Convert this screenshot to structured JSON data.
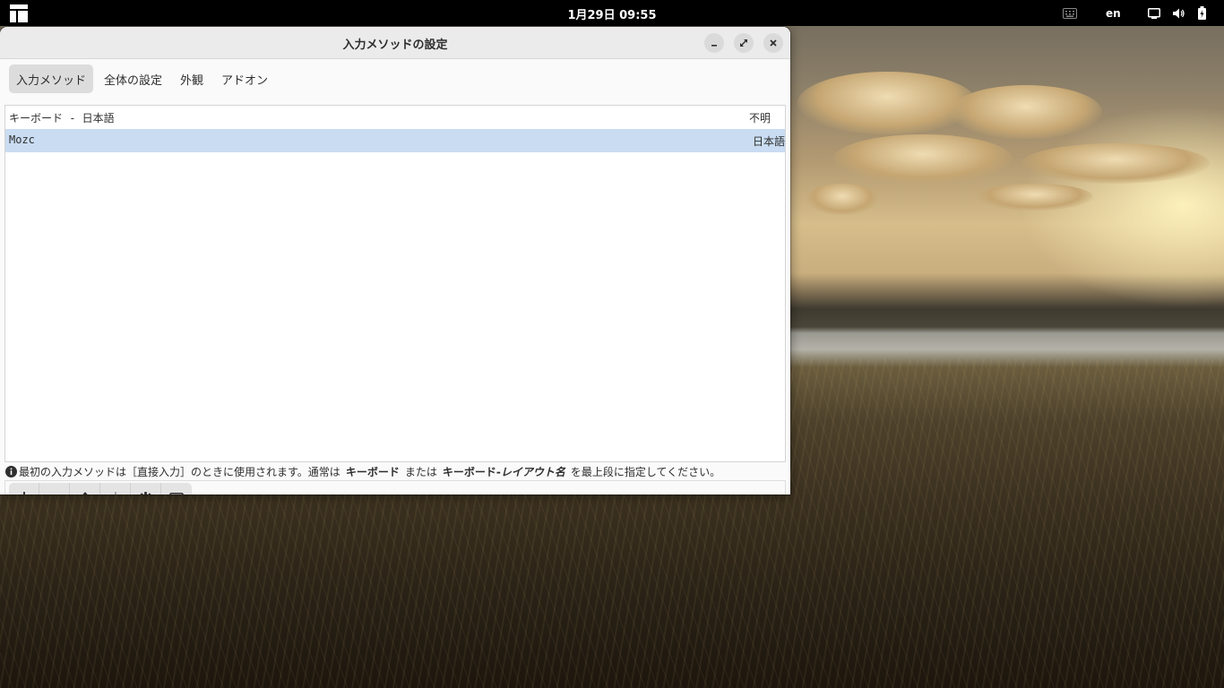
{
  "topbar": {
    "clock": "1月29日 09:55",
    "language": "en",
    "icons": [
      "activities-icon",
      "keyboard-icon",
      "display-icon",
      "volume-icon",
      "battery-icon"
    ]
  },
  "window": {
    "title": "入力メソッドの設定",
    "tabs": [
      {
        "label": "入力メソッド",
        "active": true
      },
      {
        "label": "全体の設定",
        "active": false
      },
      {
        "label": "外観",
        "active": false
      },
      {
        "label": "アドオン",
        "active": false
      }
    ],
    "input_methods": [
      {
        "name": "キーボード - 日本語",
        "language": "不明",
        "selected": false
      },
      {
        "name": "Mozc",
        "language": "日本語",
        "selected": true
      }
    ],
    "info": {
      "text_1": "最初の入力メソッドは［直接入力］のときに使用されます。通常は",
      "bold_1": "キーボード",
      "text_2": "または",
      "bold_2": "キーボード-",
      "bold_italic": "レイアウト名",
      "text_3": "を最上段に指定してください。"
    },
    "toolbar_icons": [
      "add-icon",
      "remove-icon",
      "move-up-icon",
      "move-down-icon",
      "settings-icon",
      "keyboard-layout-icon"
    ]
  },
  "colors": {
    "selection": "#c9dcf2",
    "topbar": "#000000",
    "window_bg": "#fafafa"
  }
}
